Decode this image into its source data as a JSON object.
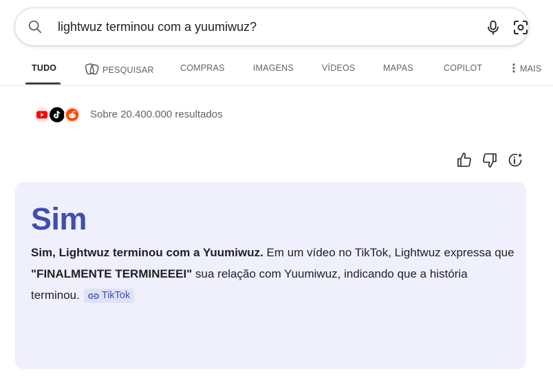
{
  "search": {
    "query": "lightwuz terminou com a yuumiwuz?"
  },
  "tabs": [
    {
      "label": "TUDO",
      "active": true
    },
    {
      "label": "PESQUISAR"
    },
    {
      "label": "COMPRAS"
    },
    {
      "label": "IMAGENS"
    },
    {
      "label": "VÍDEOS"
    },
    {
      "label": "MAPAS"
    },
    {
      "label": "COPILOT"
    },
    {
      "label": "MAIS"
    }
  ],
  "sources": {
    "icons": [
      "youtube-icon",
      "tiktok-icon",
      "reddit-icon"
    ],
    "results_count": "Sobre 20.400.000 resultados"
  },
  "answer": {
    "title": "Sim",
    "bold_lead": "Sim, Lightwuz terminou com a Yuumiwuz.",
    "text_1": " Em um vídeo no TikTok, Lightwuz expressa que ",
    "quote": "\"FINALMENTE TERMINEEEI\"",
    "text_2": " sua relação com Yuumiwuz, indicando que a história terminou.",
    "citation": "TikTok"
  },
  "colors": {
    "accent": "#3f4fb0",
    "card_bg": "#eff0fc",
    "chip_bg": "#dfe2f7",
    "youtube": "#ff0000",
    "tiktok": "#000000",
    "reddit": "#ff4500"
  }
}
